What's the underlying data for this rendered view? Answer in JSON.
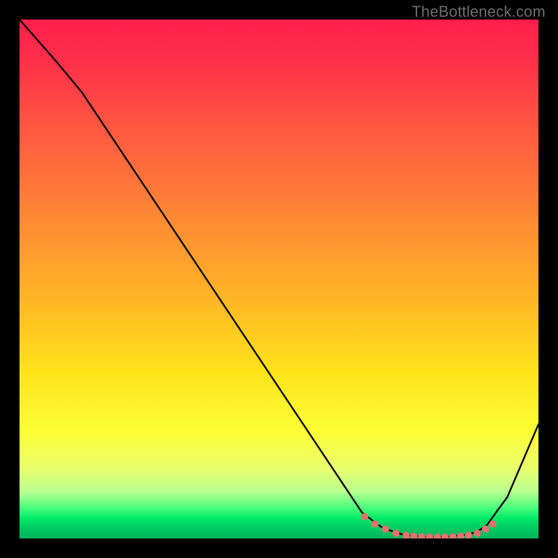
{
  "watermark": "TheBottleneck.com",
  "chart_data": {
    "type": "line",
    "title": "",
    "xlabel": "",
    "ylabel": "",
    "xlim": [
      0,
      100
    ],
    "ylim": [
      0,
      100
    ],
    "series": [
      {
        "name": "bottleneck-curve",
        "x": [
          0,
          7,
          12,
          20,
          30,
          40,
          50,
          60,
          66,
          70,
          74,
          78,
          82,
          86,
          88,
          90,
          94,
          100
        ],
        "y": [
          100,
          92,
          86,
          74,
          59,
          44,
          29,
          14,
          5,
          2,
          0.7,
          0.3,
          0.3,
          0.7,
          1.2,
          2.5,
          8,
          22
        ]
      }
    ],
    "markers": {
      "name": "highlight-points",
      "x": [
        66.5,
        68.5,
        70.5,
        72.5,
        74.5,
        76,
        77.5,
        79,
        80.5,
        82,
        83.5,
        85,
        86.5,
        88.2,
        89.8,
        91.2
      ],
      "y": [
        4.2,
        2.8,
        1.8,
        1.0,
        0.6,
        0.4,
        0.35,
        0.3,
        0.3,
        0.3,
        0.35,
        0.45,
        0.6,
        1.0,
        1.8,
        2.8
      ]
    },
    "gradient_stops": [
      {
        "pos": 0.0,
        "color": "#ff1f4c"
      },
      {
        "pos": 0.3,
        "color": "#ff7a39"
      },
      {
        "pos": 0.6,
        "color": "#ffd21e"
      },
      {
        "pos": 0.82,
        "color": "#f6ff48"
      },
      {
        "pos": 0.92,
        "color": "#8cff84"
      },
      {
        "pos": 1.0,
        "color": "#00b460"
      }
    ]
  }
}
